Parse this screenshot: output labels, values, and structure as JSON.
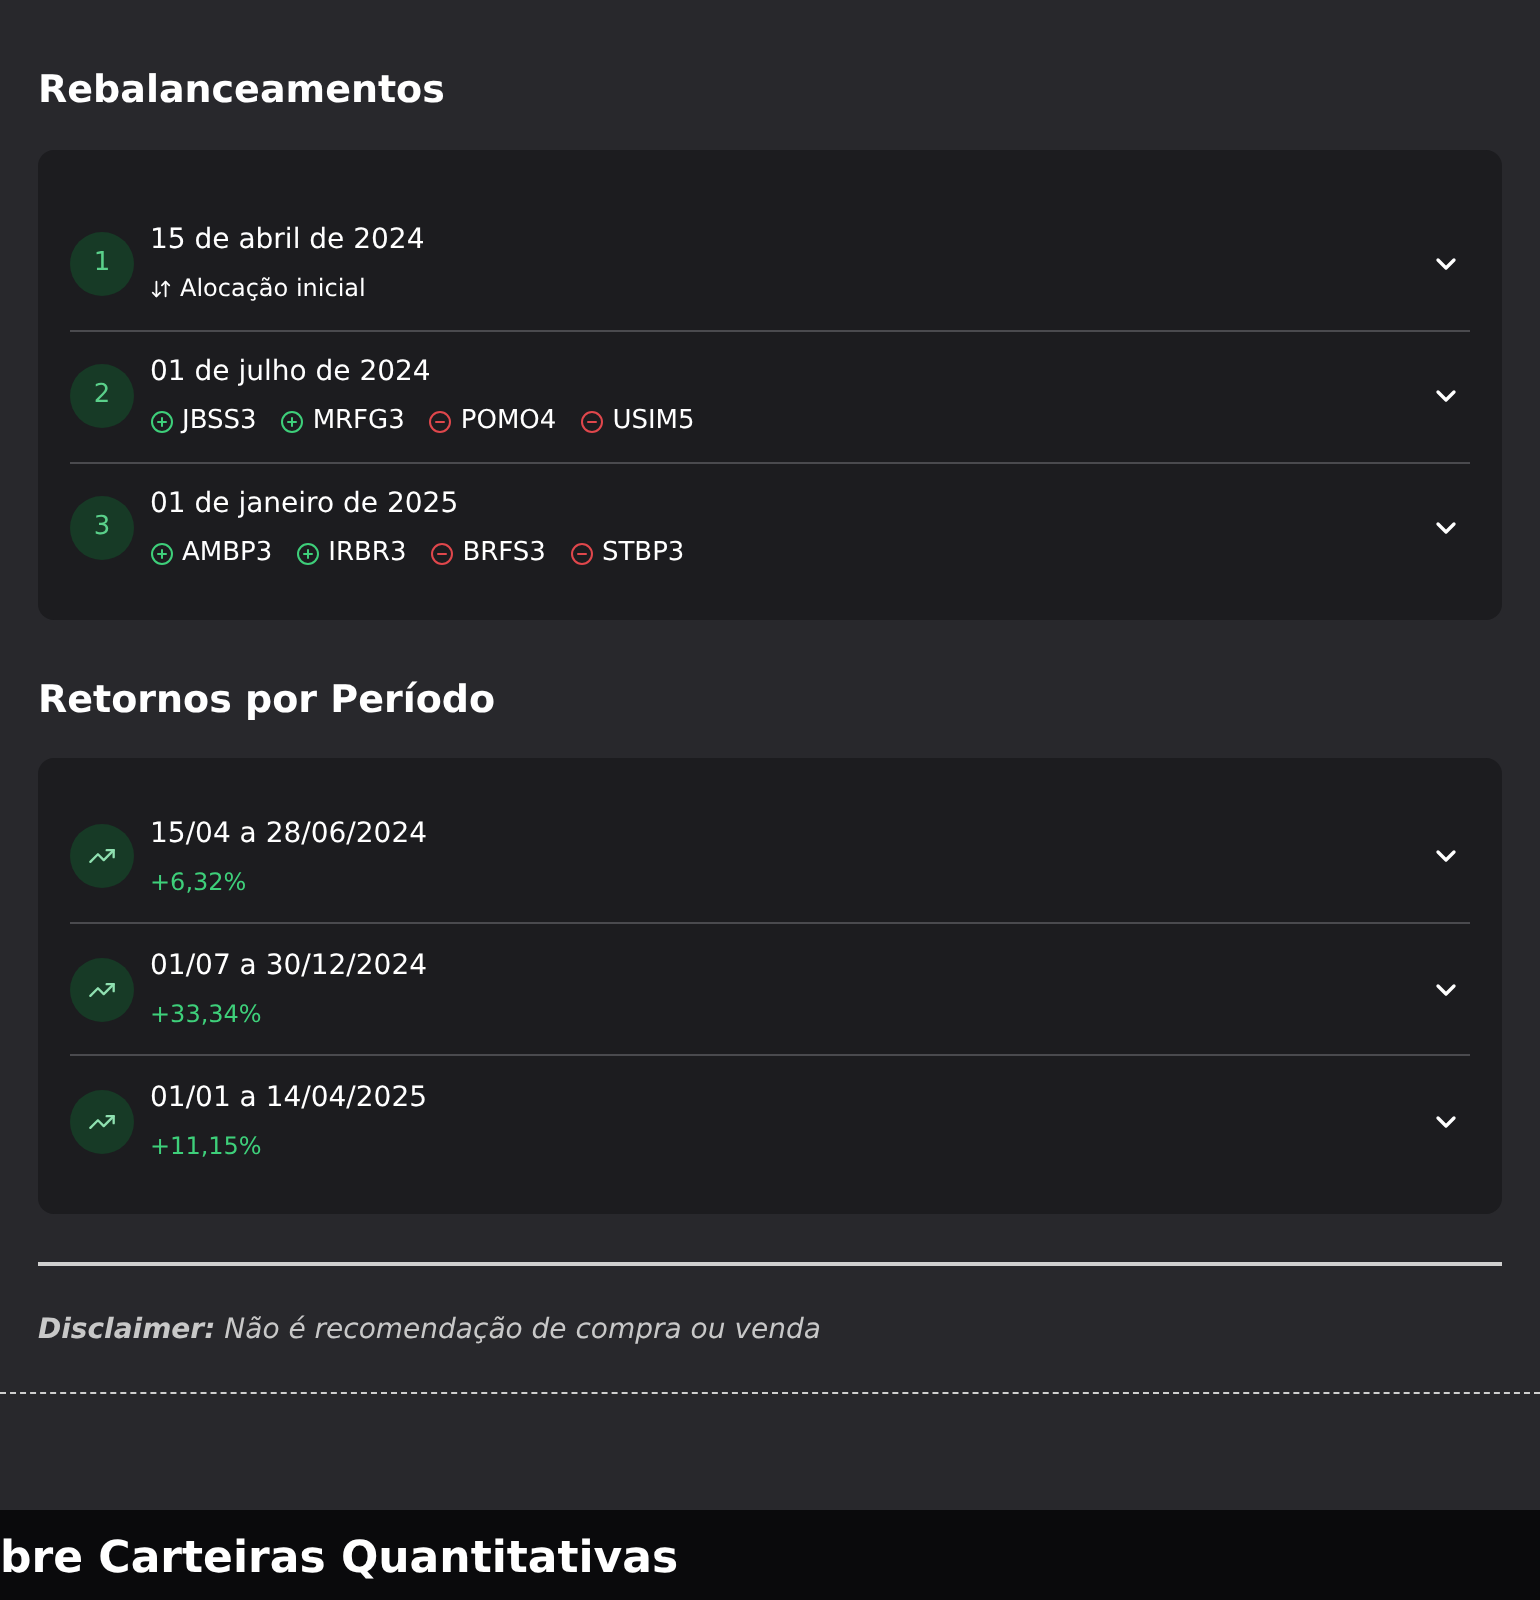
{
  "rebalances": {
    "title": "Rebalanceamentos",
    "items": [
      {
        "number": "1",
        "date": "15 de abril de 2024",
        "kind": "initial",
        "note": "Alocação inicial"
      },
      {
        "number": "2",
        "date": "01 de julho de 2024",
        "kind": "changes",
        "changes": [
          {
            "ticker": "JBSS3",
            "kind": "add"
          },
          {
            "ticker": "MRFG3",
            "kind": "add"
          },
          {
            "ticker": "POMO4",
            "kind": "remove"
          },
          {
            "ticker": "USIM5",
            "kind": "remove"
          }
        ]
      },
      {
        "number": "3",
        "date": "01 de janeiro de 2025",
        "kind": "changes",
        "changes": [
          {
            "ticker": "AMBP3",
            "kind": "add"
          },
          {
            "ticker": "IRBR3",
            "kind": "add"
          },
          {
            "ticker": "BRFS3",
            "kind": "remove"
          },
          {
            "ticker": "STBP3",
            "kind": "remove"
          }
        ]
      }
    ]
  },
  "returns": {
    "title": "Retornos por Período",
    "items": [
      {
        "period": "15/04 a 28/06/2024",
        "return": "+6,32%"
      },
      {
        "period": "01/07 a 30/12/2024",
        "return": "+33,34%"
      },
      {
        "period": "01/01 a 14/04/2025",
        "return": "+11,15%"
      }
    ]
  },
  "disclaimer": "**Disclaimer:** Não é recomendação de compra ou venda",
  "next_section_title": "bre Carteiras Quantitativas"
}
